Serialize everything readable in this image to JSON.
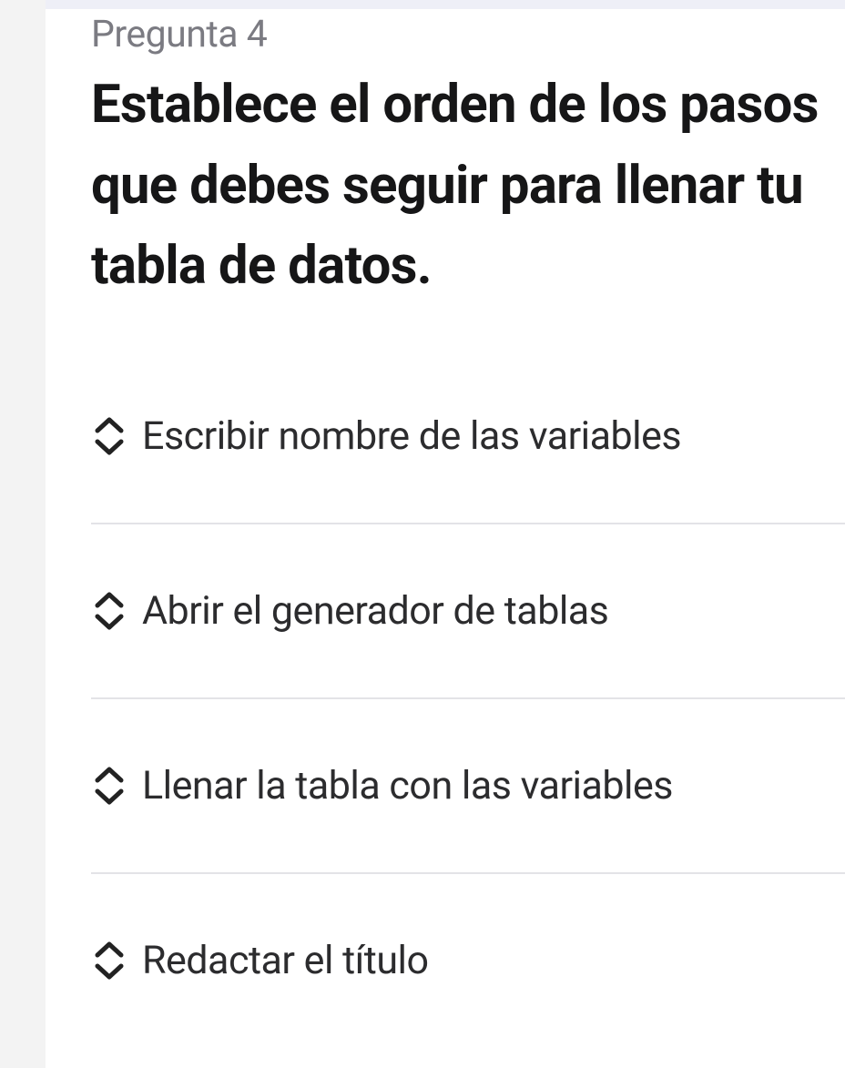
{
  "header": {
    "fragment": "datos"
  },
  "question": {
    "label": "Pregunta 4",
    "title": "Establece el orden de los pasos que debes seguir para llenar tu tabla de datos."
  },
  "items": [
    {
      "text": "Escribir nombre de las variables"
    },
    {
      "text": "Abrir el generador de tablas"
    },
    {
      "text": "Llenar la tabla con las variables"
    },
    {
      "text": "Redactar el título"
    }
  ]
}
